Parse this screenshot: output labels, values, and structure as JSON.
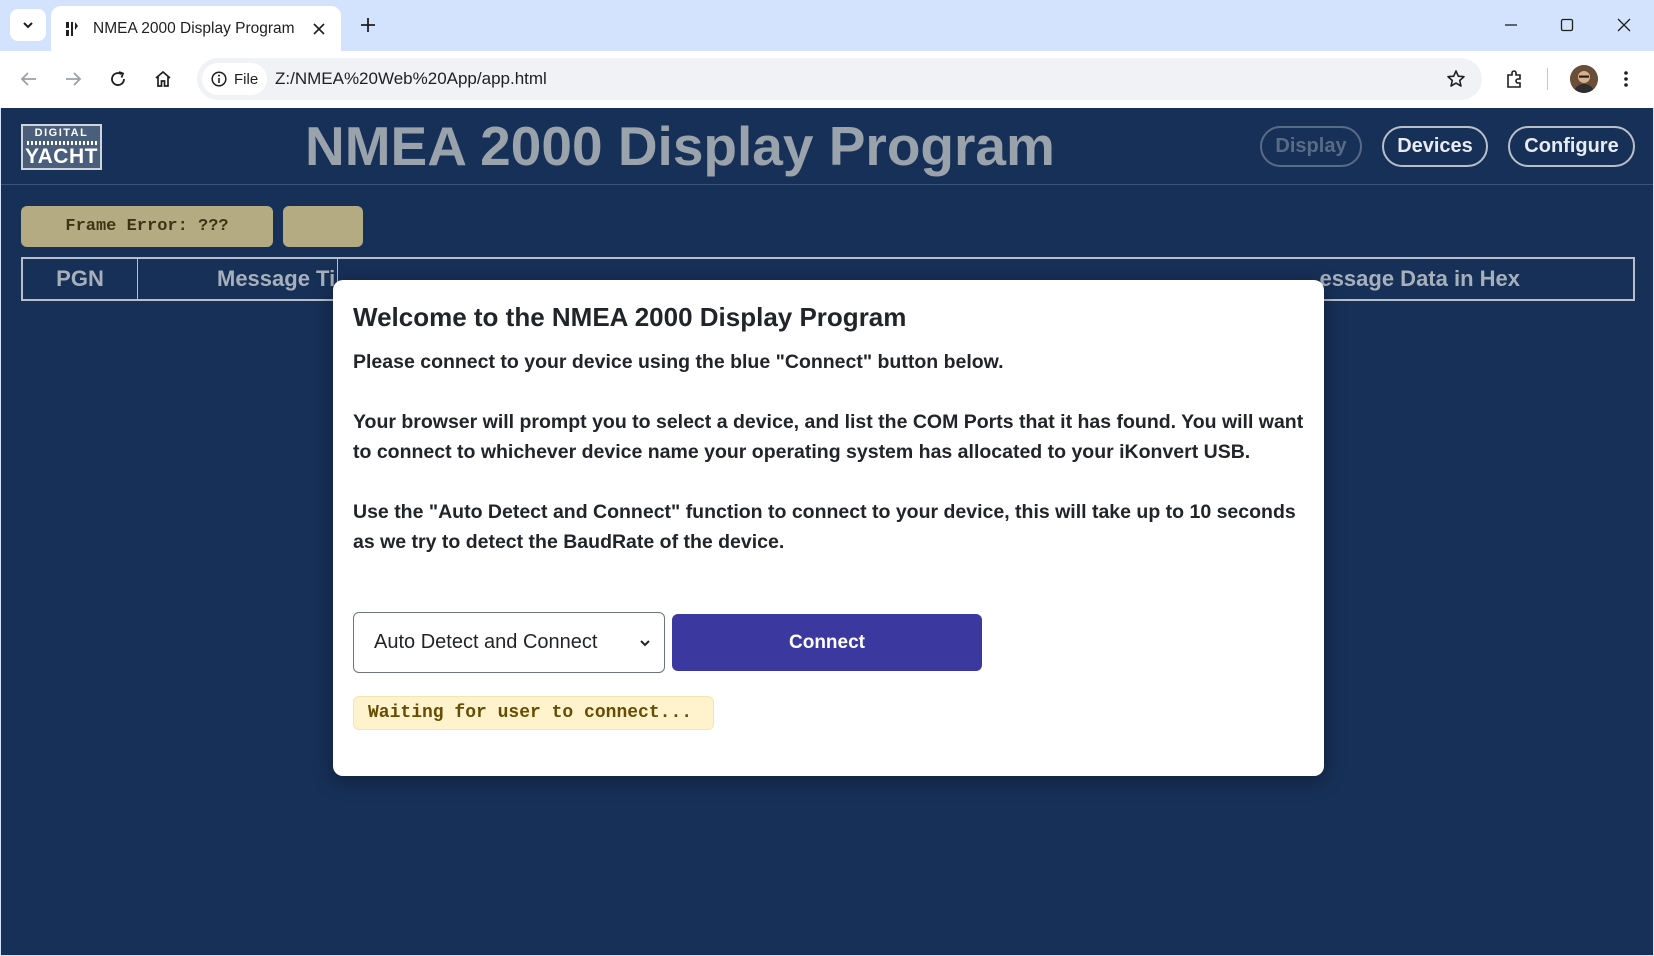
{
  "browser": {
    "tab_title": "NMEA 2000 Display Program",
    "site_chip_label": "File",
    "url": "Z:/NMEA%20Web%20App/app.html"
  },
  "header": {
    "logo_top": "DIGITAL",
    "logo_bottom": "YACHT",
    "title": "NMEA 2000 Display Program",
    "nav": {
      "display": "Display",
      "devices": "Devices",
      "configure": "Configure"
    }
  },
  "status": {
    "frame_error": "Frame Error: ???"
  },
  "table": {
    "columns": [
      "PGN",
      "Message Ti",
      "essage Data in Hex"
    ]
  },
  "modal": {
    "title": "Welcome to the NMEA 2000 Display Program",
    "p1": "Please connect to your device using the blue \"Connect\" button below.",
    "p2": "Your browser will prompt you to select a device, and list the COM Ports that it has found. You will want to connect to whichever device name your operating system has allocated to your iKonvert USB.",
    "p3": "Use the \"Auto Detect and Connect\" function to connect to your device, this will take up to 10 seconds as we try to detect the BaudRate of the device.",
    "select_value": "Auto Detect and Connect",
    "connect_label": "Connect",
    "waiting": "Waiting for user to connect..."
  },
  "colors": {
    "page_bg": "#173057",
    "connect_btn": "#3b38a0",
    "warning_bg": "#fff3cd",
    "chip_bg": "#b5ab83"
  }
}
